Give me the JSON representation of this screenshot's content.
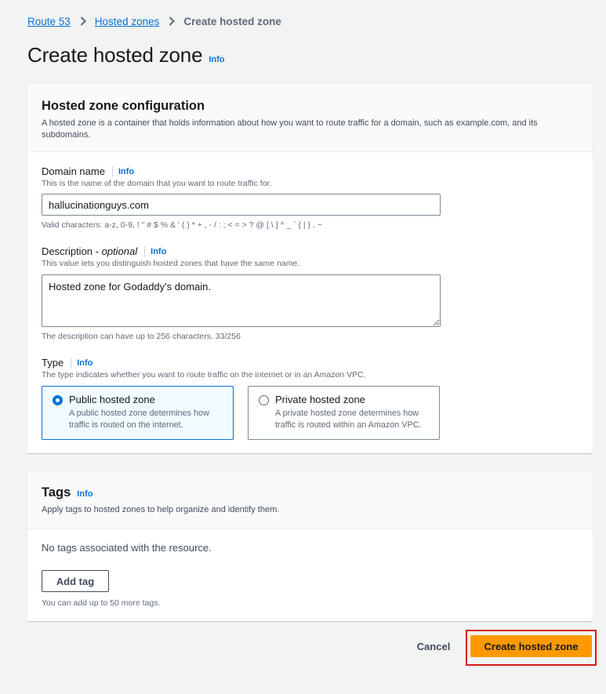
{
  "breadcrumb": {
    "items": [
      "Route 53",
      "Hosted zones"
    ],
    "current": "Create hosted zone"
  },
  "page": {
    "title": "Create hosted zone",
    "info": "Info"
  },
  "config_panel": {
    "title": "Hosted zone configuration",
    "description": "A hosted zone is a container that holds information about how you want to route traffic for a domain, such as example.com, and its subdomains.",
    "domain_name": {
      "label": "Domain name",
      "info": "Info",
      "hint": "This is the name of the domain that you want to route traffic for.",
      "value": "hallucinationguys.com",
      "constraint": "Valid characters: a-z, 0-9, ! \" # $ % & ' ( ) * + , - / : ; < = > ? @ [ \\ ] ^ _ ` { | } . ~"
    },
    "description_field": {
      "label": "Description",
      "optional": "optional",
      "info": "Info",
      "hint": "This value lets you distinguish hosted zones that have the same name.",
      "value": "Hosted zone for Godaddy's domain.",
      "constraint": "The description can have up to 256 characters. 33/256"
    },
    "type": {
      "label": "Type",
      "info": "Info",
      "hint": "The type indicates whether you want to route traffic on the internet or in an Amazon VPC.",
      "selected": "Public hosted zone",
      "options": [
        {
          "title": "Public hosted zone",
          "desc_line1": "A public hosted zone determines how",
          "desc_line2": "traffic is routed on the internet."
        },
        {
          "title": "Private hosted zone",
          "desc_line1": "A private hosted zone determines how",
          "desc_line2": "traffic is routed within an Amazon VPC."
        }
      ]
    }
  },
  "tags_panel": {
    "title": "Tags",
    "info": "Info",
    "description": "Apply tags to hosted zones to help organize and identify them.",
    "empty": "No tags associated with the resource.",
    "add_button": "Add tag",
    "limit": "You can add up to 50 more tags."
  },
  "actions": {
    "cancel": "Cancel",
    "submit": "Create hosted zone"
  },
  "colors": {
    "link": "#0972d3",
    "primary_button": "#ff9900",
    "highlight": "#d91515"
  }
}
